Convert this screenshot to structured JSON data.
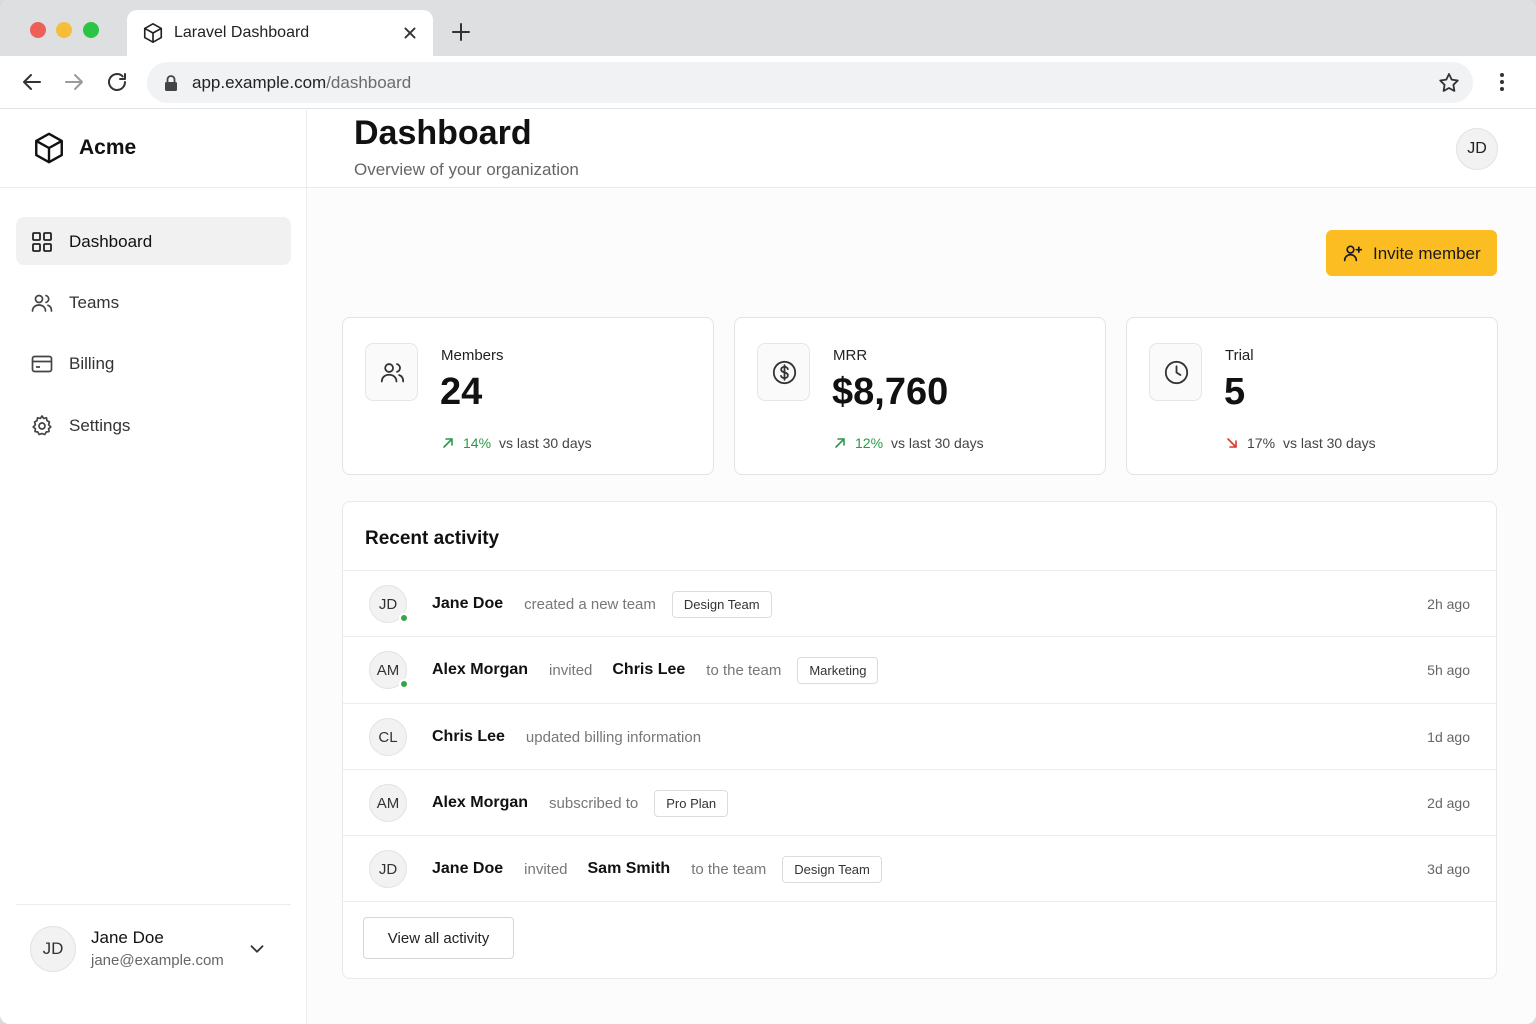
{
  "browser": {
    "tab_title": "Laravel Dashboard",
    "url_host": "app.example.com",
    "url_path": "/dashboard"
  },
  "brand": {
    "name": "Acme"
  },
  "sidebar": {
    "items": [
      {
        "label": "Dashboard",
        "icon": "grid-icon",
        "active": true
      },
      {
        "label": "Teams",
        "icon": "users-icon",
        "active": false
      },
      {
        "label": "Billing",
        "icon": "credit-card-icon",
        "active": false
      },
      {
        "label": "Settings",
        "icon": "gear-icon",
        "active": false
      }
    ]
  },
  "user": {
    "initials": "JD",
    "name": "Jane Doe",
    "email": "jane@example.com"
  },
  "header": {
    "title": "Dashboard",
    "subtitle": "Overview of your organization",
    "invite_label": "Invite member"
  },
  "stats": [
    {
      "label": "Members",
      "value": "24",
      "pct": "14%",
      "trend_text": "vs last 30 days",
      "direction": "up",
      "icon": "users-icon"
    },
    {
      "label": "MRR",
      "value": "$8,760",
      "pct": "12%",
      "trend_text": "vs last 30 days",
      "direction": "up",
      "icon": "dollar-icon"
    },
    {
      "label": "Trial",
      "value": "5",
      "pct": "17%",
      "trend_text": "vs last 30 days",
      "direction": "down",
      "icon": "clock-icon"
    }
  ],
  "activity": {
    "title": "Recent activity",
    "rows": [
      {
        "initials": "JD",
        "online": true,
        "actor": "Jane Doe",
        "action": "created a new team",
        "target": "",
        "suffix": "",
        "chip": "Design Team",
        "time": "2h ago"
      },
      {
        "initials": "AM",
        "online": true,
        "actor": "Alex Morgan",
        "action": "invited",
        "target": "Chris Lee",
        "suffix": "to the team",
        "chip": "Marketing",
        "time": "5h ago"
      },
      {
        "initials": "CL",
        "online": false,
        "actor": "Chris Lee",
        "action": "updated billing information",
        "target": "",
        "suffix": "",
        "chip": "",
        "time": "1d ago"
      },
      {
        "initials": "AM",
        "online": false,
        "actor": "Alex Morgan",
        "action": "subscribed to",
        "target": "",
        "suffix": "",
        "chip": "Pro Plan",
        "time": "2d ago"
      },
      {
        "initials": "JD",
        "online": false,
        "actor": "Jane Doe",
        "action": "invited",
        "target": "Sam Smith",
        "suffix": "to the team",
        "chip": "Design Team",
        "time": "3d ago"
      }
    ],
    "view_all_label": "View all activity"
  },
  "colors": {
    "accent": "#fbbd22",
    "trend_up": "#2b9a48",
    "trend_down": "#d93a2b",
    "online": "#33a64b"
  }
}
